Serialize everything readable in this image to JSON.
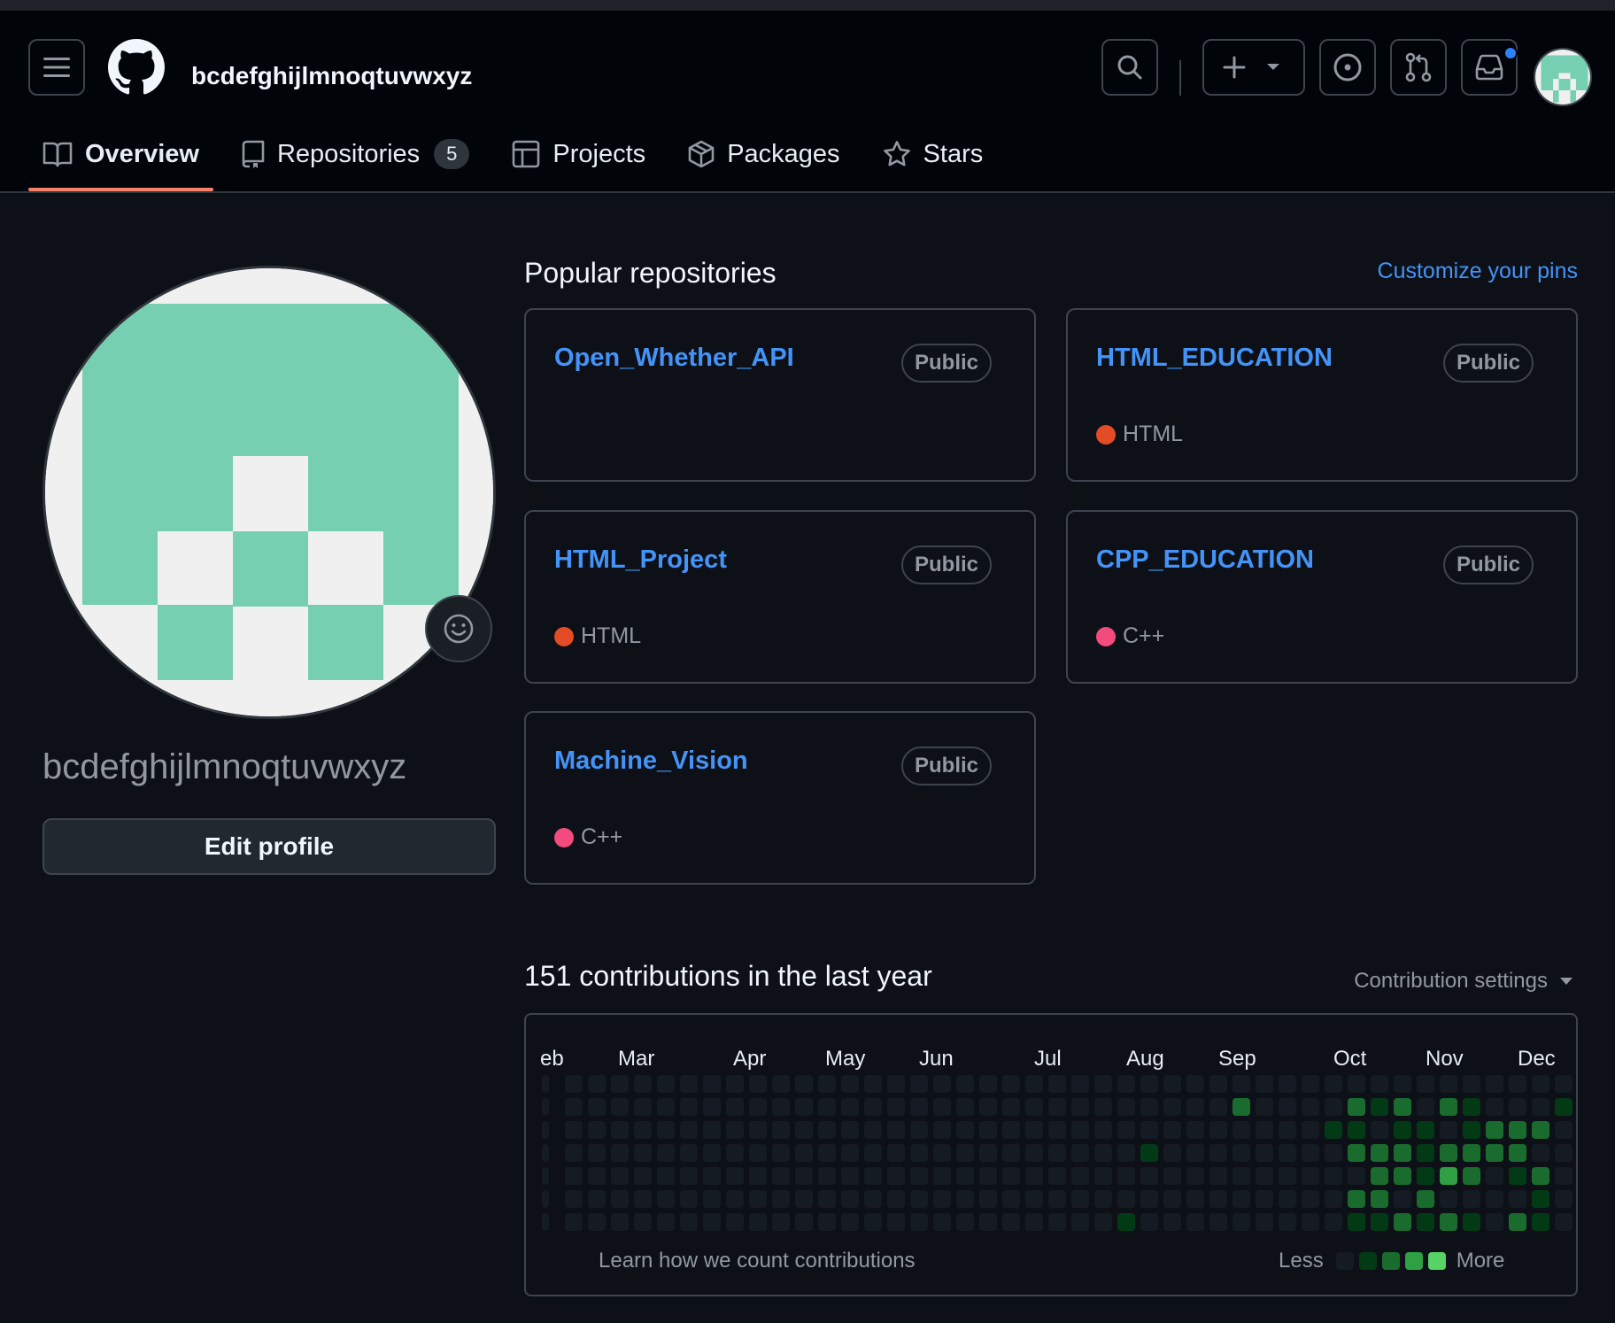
{
  "header": {
    "username": "bcdefghijlmnoqtuvwxyz",
    "has_notification": true
  },
  "tabs": [
    {
      "label": "Overview",
      "icon": "book-icon",
      "active": true
    },
    {
      "label": "Repositories",
      "icon": "repo-icon",
      "count": "5"
    },
    {
      "label": "Projects",
      "icon": "table-icon"
    },
    {
      "label": "Packages",
      "icon": "package-icon"
    },
    {
      "label": "Stars",
      "icon": "star-icon"
    }
  ],
  "profile": {
    "name": "bcdefghijlmnoqtuvwxyz",
    "edit_label": "Edit profile",
    "avatar_color": "#76cfb0"
  },
  "popular": {
    "title": "Popular repositories",
    "customize_label": "Customize your pins",
    "repos": [
      {
        "name": "Open_Whether_API",
        "visibility": "Public",
        "language": "",
        "lang_color": ""
      },
      {
        "name": "HTML_EDUCATION",
        "visibility": "Public",
        "language": "HTML",
        "lang_color": "#e34c26"
      },
      {
        "name": "HTML_Project",
        "visibility": "Public",
        "language": "HTML",
        "lang_color": "#e34c26"
      },
      {
        "name": "CPP_EDUCATION",
        "visibility": "Public",
        "language": "C++",
        "lang_color": "#f34b7d"
      },
      {
        "name": "Machine_Vision",
        "visibility": "Public",
        "language": "C++",
        "lang_color": "#f34b7d"
      }
    ]
  },
  "contributions": {
    "title": "151 contributions in the last year",
    "settings_label": "Contribution settings",
    "months": [
      "eb",
      "Mar",
      "Apr",
      "May",
      "Jun",
      "Jul",
      "Aug",
      "Sep",
      "Oct",
      "Nov",
      "Dec"
    ],
    "learn_label": "Learn how we count contributions",
    "less_label": "Less",
    "more_label": "More",
    "level_colors": [
      "#151b23",
      "#033a16",
      "#196c2e",
      "#2ea043",
      "#56d364"
    ],
    "active_cells": [
      [
        26,
        3,
        1
      ],
      [
        34,
        2,
        1
      ],
      [
        35,
        2,
        1
      ],
      [
        36,
        1,
        1
      ],
      [
        37,
        2,
        1
      ],
      [
        38,
        2,
        1
      ],
      [
        39,
        1,
        1
      ],
      [
        40,
        2,
        1
      ],
      [
        41,
        3,
        1
      ],
      [
        42,
        2,
        1
      ],
      [
        43,
        2,
        1
      ],
      [
        44,
        1,
        1
      ],
      [
        25,
        6,
        1
      ],
      [
        35,
        1,
        2
      ],
      [
        36,
        3,
        1
      ],
      [
        37,
        3,
        2
      ],
      [
        38,
        4,
        1
      ],
      [
        39,
        1,
        2
      ],
      [
        40,
        1,
        1
      ],
      [
        41,
        2,
        1
      ],
      [
        42,
        3,
        1
      ],
      [
        36,
        3,
        2
      ],
      [
        36,
        5,
        2
      ],
      [
        37,
        1,
        2
      ],
      [
        37,
        4,
        2
      ],
      [
        38,
        5,
        2
      ],
      [
        39,
        3,
        2
      ],
      [
        40,
        3,
        2
      ],
      [
        41,
        3,
        2
      ],
      [
        42,
        2,
        2
      ],
      [
        43,
        2,
        2
      ],
      [
        35,
        3,
        2
      ],
      [
        35,
        5,
        2
      ],
      [
        36,
        4,
        2
      ],
      [
        37,
        3,
        2
      ],
      [
        38,
        5,
        2
      ],
      [
        39,
        4,
        3
      ],
      [
        40,
        4,
        2
      ],
      [
        41,
        2,
        2
      ],
      [
        42,
        3,
        2
      ],
      [
        43,
        4,
        2
      ],
      [
        37,
        3,
        1
      ],
      [
        38,
        3,
        1
      ],
      [
        39,
        3,
        1
      ],
      [
        40,
        2,
        1
      ],
      [
        41,
        3,
        1
      ],
      [
        42,
        4,
        1
      ],
      [
        43,
        5,
        1
      ],
      [
        30,
        1,
        2
      ],
      [
        35,
        6,
        1
      ],
      [
        36,
        6,
        1
      ],
      [
        37,
        6,
        2
      ],
      [
        38,
        6,
        1
      ],
      [
        39,
        6,
        2
      ],
      [
        40,
        6,
        1
      ],
      [
        42,
        6,
        2
      ],
      [
        43,
        6,
        1
      ]
    ]
  }
}
